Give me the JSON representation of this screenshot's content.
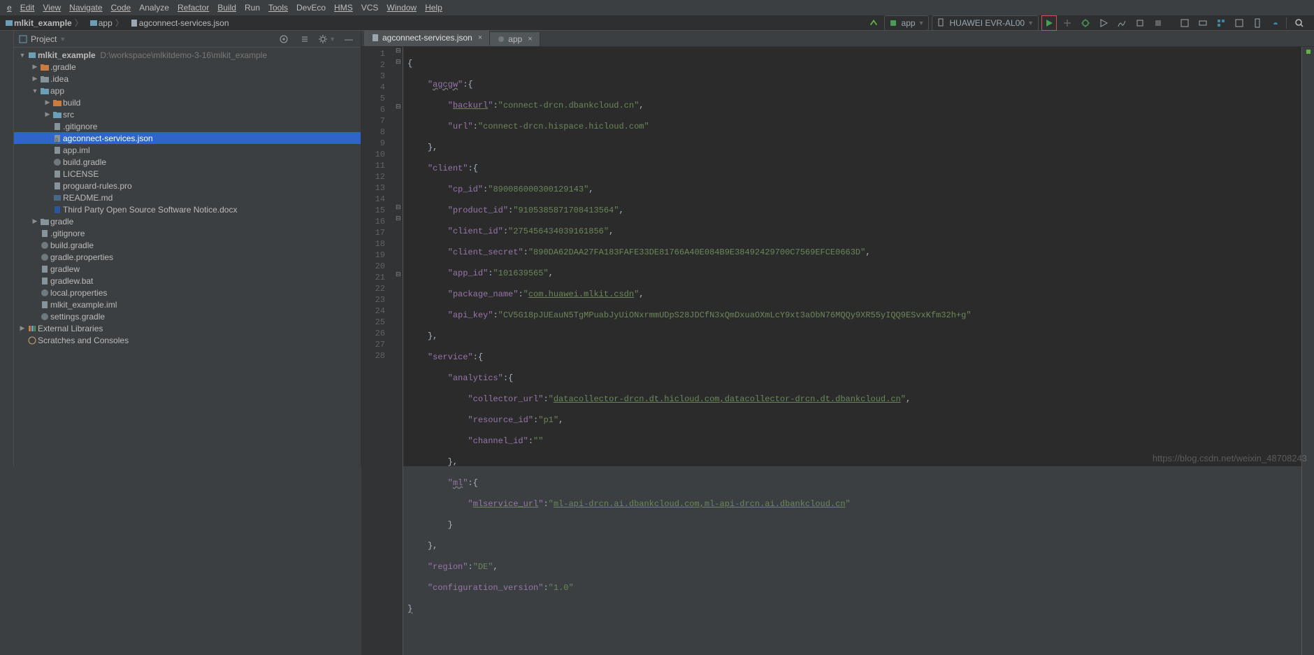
{
  "menu": [
    "e",
    "Edit",
    "View",
    "Navigate",
    "Code",
    "Analyze",
    "Refactor",
    "Build",
    "Run",
    "Tools",
    "DevEco",
    "HMS",
    "VCS",
    "Window",
    "Help"
  ],
  "breadcrumbs": [
    "mlkit_example",
    "app",
    "agconnect-services.json"
  ],
  "run_config": {
    "module": "app",
    "device": "HUAWEI EVR-AL00"
  },
  "project": {
    "title": "Project",
    "root": {
      "name": "mlkit_example",
      "path": "D:\\workspace\\mlkitdemo-3-16\\mlkit_example"
    },
    "nodes": [
      {
        "depth": 1,
        "expand": "",
        "icon": "folder-o",
        "label": ".gradle"
      },
      {
        "depth": 1,
        "expand": "",
        "icon": "folder-g",
        "label": ".idea"
      },
      {
        "depth": 1,
        "expand": "v",
        "icon": "folder-b",
        "label": "app"
      },
      {
        "depth": 2,
        "expand": "",
        "icon": "folder-o",
        "label": "build"
      },
      {
        "depth": 2,
        "expand": "",
        "icon": "folder-b",
        "label": "src"
      },
      {
        "depth": 2,
        "expand": " ",
        "icon": "file",
        "label": ".gitignore"
      },
      {
        "depth": 2,
        "expand": " ",
        "icon": "json",
        "label": "agconnect-services.json",
        "selected": true
      },
      {
        "depth": 2,
        "expand": " ",
        "icon": "file",
        "label": "app.iml"
      },
      {
        "depth": 2,
        "expand": " ",
        "icon": "gradle",
        "label": "build.gradle"
      },
      {
        "depth": 2,
        "expand": " ",
        "icon": "file",
        "label": "LICENSE"
      },
      {
        "depth": 2,
        "expand": " ",
        "icon": "file",
        "label": "proguard-rules.pro"
      },
      {
        "depth": 2,
        "expand": " ",
        "icon": "md",
        "label": "README.md"
      },
      {
        "depth": 2,
        "expand": " ",
        "icon": "doc",
        "label": "Third Party Open Source Software Notice.docx"
      },
      {
        "depth": 1,
        "expand": "",
        "icon": "folder-g",
        "label": "gradle"
      },
      {
        "depth": 1,
        "expand": " ",
        "icon": "file",
        "label": ".gitignore"
      },
      {
        "depth": 1,
        "expand": " ",
        "icon": "gradle",
        "label": "build.gradle"
      },
      {
        "depth": 1,
        "expand": " ",
        "icon": "gradle",
        "label": "gradle.properties"
      },
      {
        "depth": 1,
        "expand": " ",
        "icon": "file",
        "label": "gradlew"
      },
      {
        "depth": 1,
        "expand": " ",
        "icon": "bat",
        "label": "gradlew.bat"
      },
      {
        "depth": 1,
        "expand": " ",
        "icon": "gradle",
        "label": "local.properties"
      },
      {
        "depth": 1,
        "expand": " ",
        "icon": "file",
        "label": "mlkit_example.iml"
      },
      {
        "depth": 1,
        "expand": " ",
        "icon": "gradle",
        "label": "settings.gradle"
      }
    ],
    "ext_lib": "External Libraries",
    "scratches": "Scratches and Consoles"
  },
  "tabs": [
    {
      "label": "agconnect-services.json",
      "icon": "json",
      "active": true
    },
    {
      "label": "app",
      "icon": "gradle",
      "active": false
    }
  ],
  "code_lines": 28,
  "code": {
    "l1": "{",
    "l2_k": "agcgw",
    "l2_v": ":{",
    "l3_k": "backurl",
    "l3_v": "connect-drcn.dbankcloud.cn",
    "l4_k": "url",
    "l4_v": "connect-drcn.hispace.hicloud.com",
    "l5": "},",
    "l6_k": "client",
    "l6_v": ":{",
    "l7_k": "cp_id",
    "l7_v": "890086000300129143",
    "l8_k": "product_id",
    "l8_v": "9105385871708413564",
    "l9_k": "client_id",
    "l9_v": "275456434039161856",
    "l10_k": "client_secret",
    "l10_v": "890DA62DAA27FA183FAFE33DE81766A40E084B9E38492429700C7569EFCE0663D",
    "l11_k": "app_id",
    "l11_v": "101639565",
    "l12_k": "package_name",
    "l12_v": "com.huawei.mlkit.csdn",
    "l13_k": "api_key",
    "l13_v": "CV5G18pJUEauN5TgMPuabJyUiONxrmmUDpS28JDCfN3xQmDxuaOXmLcY9xt3aObN76MQQy9XR55yIQQ9ESvxKfm32h+g",
    "l14": "},",
    "l15_k": "service",
    "l15_v": ":{",
    "l16_k": "analytics",
    "l16_v": ":{",
    "l17_k": "collector_url",
    "l17_v": "datacollector-drcn.dt.hicloud.com,datacollector-drcn.dt.dbankcloud.cn",
    "l18_k": "resource_id",
    "l18_v": "p1",
    "l19_k": "channel_id",
    "l19_v": "",
    "l20": "},",
    "l21_k": "ml",
    "l21_v": ":{",
    "l22_k": "mlservice_url",
    "l22_v": "ml-api-drcn.ai.dbankcloud.com,ml-api-drcn.ai.dbankcloud.cn",
    "l23": "}",
    "l24": "},",
    "l25_k": "region",
    "l25_v": "DE",
    "l26_k": "configuration_version",
    "l26_v": "1.0",
    "l27": "}"
  },
  "watermark": "https://blog.csdn.net/weixin_48708243"
}
